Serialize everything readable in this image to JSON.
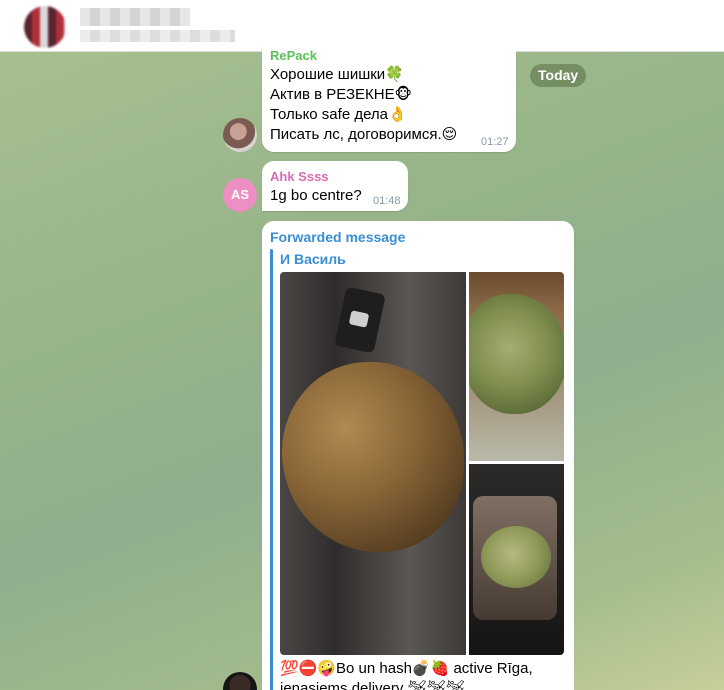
{
  "header": {
    "title": "",
    "subtitle": ""
  },
  "date_separator": "Today",
  "messages": [
    {
      "sender": "RePack",
      "sender_color": "#5ac05a",
      "lines": [
        "Хорошие шишки🍀",
        "Актив в РЕЗЕКНЕ🐵",
        "Только safe дела👌",
        "Писать лс, договоримся.😌"
      ],
      "time": "01:27"
    },
    {
      "sender": "Ahk Ssss",
      "sender_color": "#d86bb4",
      "avatar_initials": "AS",
      "avatar_color": "#ee8fc4",
      "text": "1g bo centre?",
      "time": "01:48"
    },
    {
      "forwarded_label": "Forwarded message",
      "forward_from": "И Василь",
      "link_color": "#3a8fd4",
      "photo_count": 3,
      "text_line1": "💯⛔🤪Bo un hash💣🍓 active Rīga,",
      "text_line2": "ienasiems delivery 🛩🛩🛩"
    }
  ]
}
